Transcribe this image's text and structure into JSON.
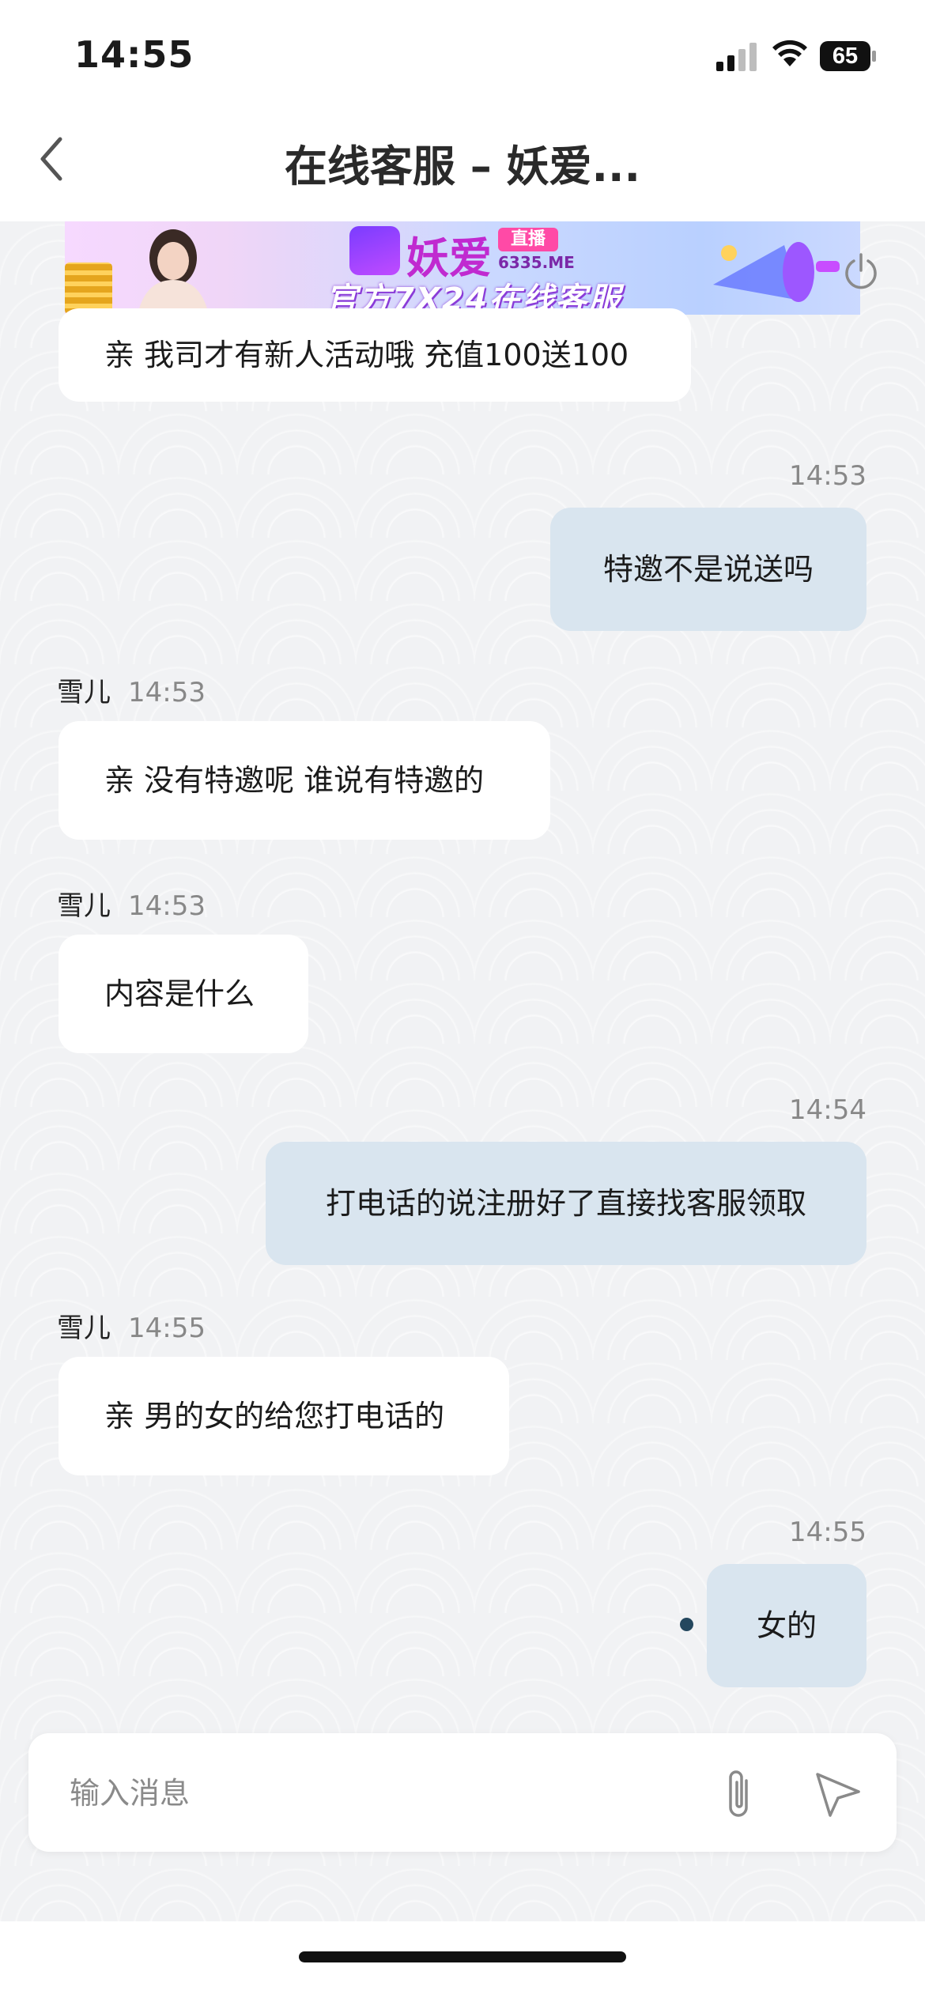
{
  "status_bar": {
    "time": "14:55",
    "battery": "65"
  },
  "nav": {
    "title": "在线客服 – 妖爱..."
  },
  "banner": {
    "brand_name": "妖爱",
    "live_badge": "直播",
    "domain": "6335.ME",
    "slogan": "官方7X24在线客服"
  },
  "messages": [
    {
      "direction": "in",
      "text": "亲 我司才有新人活动哦 充值100送100"
    },
    {
      "direction": "out",
      "time": "14:53",
      "text": "特邀不是说送吗"
    },
    {
      "direction": "in",
      "sender": "雪儿",
      "time": "14:53",
      "text": "亲 没有特邀呢 谁说有特邀的"
    },
    {
      "direction": "in",
      "sender": "雪儿",
      "time": "14:53",
      "text": "内容是什么"
    },
    {
      "direction": "out",
      "time": "14:54",
      "text": "打电话的说注册好了直接找客服领取"
    },
    {
      "direction": "in",
      "sender": "雪儿",
      "time": "14:55",
      "text": "亲 男的女的给您打电话的"
    },
    {
      "direction": "out",
      "time": "14:55",
      "text": "女的",
      "status": "sending"
    }
  ],
  "input": {
    "placeholder": "输入消息",
    "value": ""
  },
  "colors": {
    "incoming_bubble": "#ffffff",
    "outgoing_bubble": "#d9e5ef",
    "sent_dot": "#24475e",
    "chat_background": "#f1f2f4"
  }
}
